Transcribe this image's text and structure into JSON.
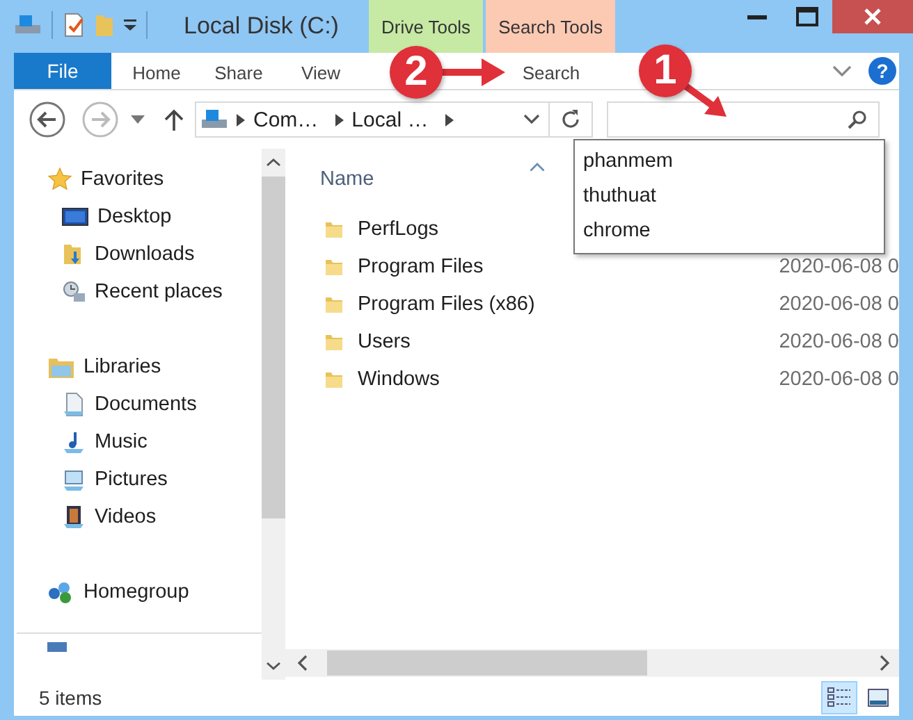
{
  "window": {
    "title": "Local Disk (C:)"
  },
  "contextual_tabs": [
    {
      "label": "Drive Tools",
      "color": "#c6e9a4"
    },
    {
      "label": "Search Tools",
      "color": "#fcc9b3"
    }
  ],
  "ribbon_tabs": [
    {
      "label": "File",
      "kind": "file"
    },
    {
      "label": "Home",
      "kind": "tab"
    },
    {
      "label": "Share",
      "kind": "tab"
    },
    {
      "label": "View",
      "kind": "tab"
    },
    {
      "label": "Search",
      "kind": "tab"
    }
  ],
  "address": {
    "crumbs": [
      "Com…",
      "Local …"
    ]
  },
  "search": {
    "suggestions": [
      "phanmem",
      "thuthuat",
      "chrome"
    ]
  },
  "nav": {
    "groups": [
      {
        "label": "Favorites",
        "kind": "star",
        "children": [
          {
            "label": "Desktop",
            "kind": "desktop"
          },
          {
            "label": "Downloads",
            "kind": "downloads"
          },
          {
            "label": "Recent places",
            "kind": "recent"
          }
        ]
      },
      {
        "label": "Libraries",
        "kind": "libraries",
        "children": [
          {
            "label": "Documents",
            "kind": "documents"
          },
          {
            "label": "Music",
            "kind": "music"
          },
          {
            "label": "Pictures",
            "kind": "pictures"
          },
          {
            "label": "Videos",
            "kind": "videos"
          }
        ]
      },
      {
        "label": "Homegroup",
        "kind": "homegroup"
      }
    ]
  },
  "file_list": {
    "columns": [
      "Name"
    ],
    "rows": [
      {
        "name": "PerfLogs"
      },
      {
        "name": "Program Files",
        "date": "2020-06-08 0"
      },
      {
        "name": "Program Files (x86)",
        "date": "2020-06-08 0"
      },
      {
        "name": "Users",
        "date": "2020-06-08 0"
      },
      {
        "name": "Windows",
        "date": "2020-06-08 0"
      }
    ]
  },
  "status_bar": {
    "item_count": "5 items",
    "views": [
      {
        "kind": "details",
        "selected": true
      },
      {
        "kind": "tiles",
        "selected": false
      }
    ]
  },
  "help_button": {
    "label": "?"
  },
  "annotations": [
    {
      "label": "2"
    },
    {
      "label": "1"
    }
  ]
}
